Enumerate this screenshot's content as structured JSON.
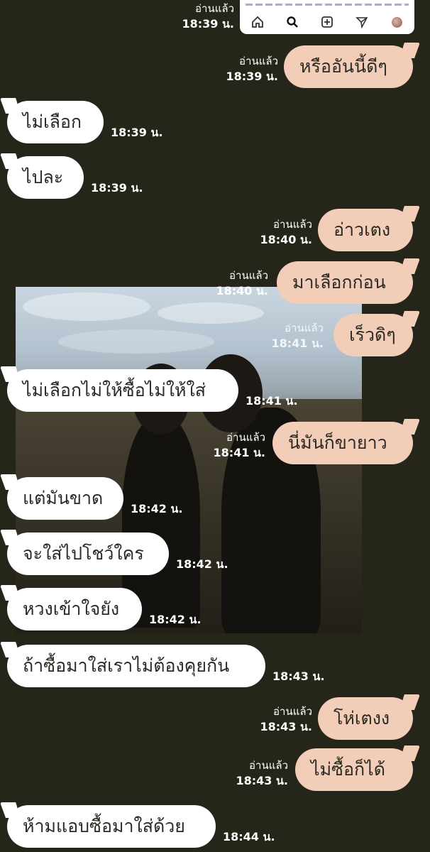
{
  "shared_screenshot": {
    "read": "อ่านแล้ว",
    "time": "18:39 น.",
    "icons": [
      "home-icon",
      "search-icon",
      "add-post-icon",
      "send-icon",
      "profile-avatar-icon"
    ]
  },
  "messages": [
    {
      "side": "out",
      "text": "หรืออันนี้ดีๆ",
      "read": "อ่านแล้ว",
      "time": "18:39 น."
    },
    {
      "side": "in",
      "text": "ไม่เลือก",
      "time": "18:39 น."
    },
    {
      "side": "in",
      "text": "ไปละ",
      "time": "18:39 น."
    },
    {
      "side": "out",
      "text": "อ่าวเตง",
      "read": "อ่านแล้ว",
      "time": "18:40 น."
    },
    {
      "side": "out",
      "text": "มาเลือกก่อน",
      "read": "อ่านแล้ว",
      "time": "18:40 น."
    },
    {
      "side": "out",
      "text": "เร็วดิๆ",
      "read": "อ่านแล้ว",
      "time": "18:41 น."
    },
    {
      "side": "in",
      "text": "ไม่เลือกไม่ให้ซื้อไม่ให้ใส่",
      "time": "18:41 น."
    },
    {
      "side": "out",
      "text": "นี่มันก็ขายาว",
      "read": "อ่านแล้ว",
      "time": "18:41 น."
    },
    {
      "side": "in",
      "text": "แต่มันขาด",
      "time": "18:42 น."
    },
    {
      "side": "in",
      "text": "จะใส่ไปโชว์ใคร",
      "time": "18:42 น."
    },
    {
      "side": "in",
      "text": "หวงเข้าใจยัง",
      "time": "18:42 น."
    },
    {
      "side": "in",
      "text": "ถ้าซื้อมาใส่เราไม่ต้องคุยกัน",
      "time": "18:43 น."
    },
    {
      "side": "out",
      "text": "โห่เตงง",
      "read": "อ่านแล้ว",
      "time": "18:43 น."
    },
    {
      "side": "out",
      "text": "ไม่ซื้อก็ได้",
      "read": "อ่านแล้ว",
      "time": "18:43 น."
    },
    {
      "side": "in",
      "text": "ห้ามแอบซื้อมาใส่ด้วย",
      "time": "18:44 น."
    }
  ]
}
